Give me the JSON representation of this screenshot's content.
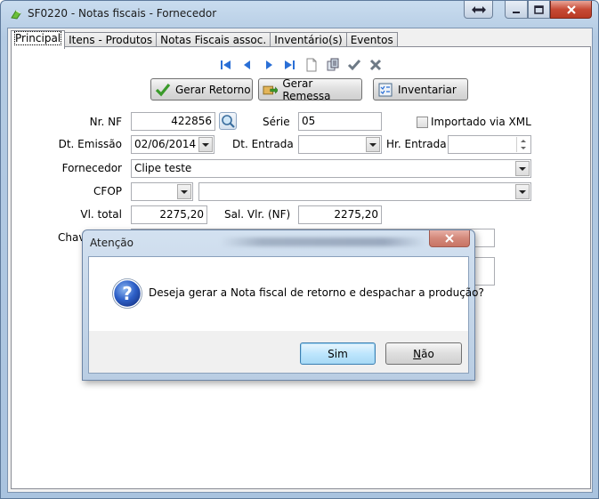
{
  "window": {
    "title": "SF0220 - Notas fiscais -  Fornecedor"
  },
  "tabs": [
    {
      "label": "Principal"
    },
    {
      "label": "Itens - Produtos"
    },
    {
      "label": "Notas Fiscais assoc."
    },
    {
      "label": "Inventário(s)"
    },
    {
      "label": "Eventos"
    }
  ],
  "actions": {
    "gerar_retorno": "Gerar Retorno",
    "gerar_remessa": "Gerar Remessa",
    "inventariar": "Inventariar"
  },
  "form": {
    "nr_nf_label": "Nr. NF",
    "nr_nf_value": "422856",
    "serie_label": "Série",
    "serie_value": "05",
    "importado_label": "Importado via XML",
    "dt_emissao_label": "Dt. Emissão",
    "dt_emissao_value": "02/06/2014",
    "dt_entrada_label": "Dt. Entrada",
    "dt_entrada_value": "",
    "hr_entrada_label": "Hr. Entrada",
    "hr_entrada_value": "",
    "fornecedor_label": "Fornecedor",
    "fornecedor_value": "Clipe teste",
    "cfop_label": "CFOP",
    "cfop_value": "",
    "cfop_desc_value": "",
    "vl_total_label": "Vl. total",
    "vl_total_value": "2275,20",
    "sal_vlr_label": "Sal. Vlr. (NF)",
    "sal_vlr_value": "2275,20",
    "chave_label": "Chav"
  },
  "dialog": {
    "title": "Atenção",
    "message": "Deseja gerar a Nota fiscal de retorno e despachar a produção?",
    "yes_label": "Sim",
    "no_label_rest": "ão",
    "no_label_mnemonic": "N"
  },
  "colors": {
    "nav_blue": "#2a6fd6",
    "check_green": "#3a9a2a"
  }
}
